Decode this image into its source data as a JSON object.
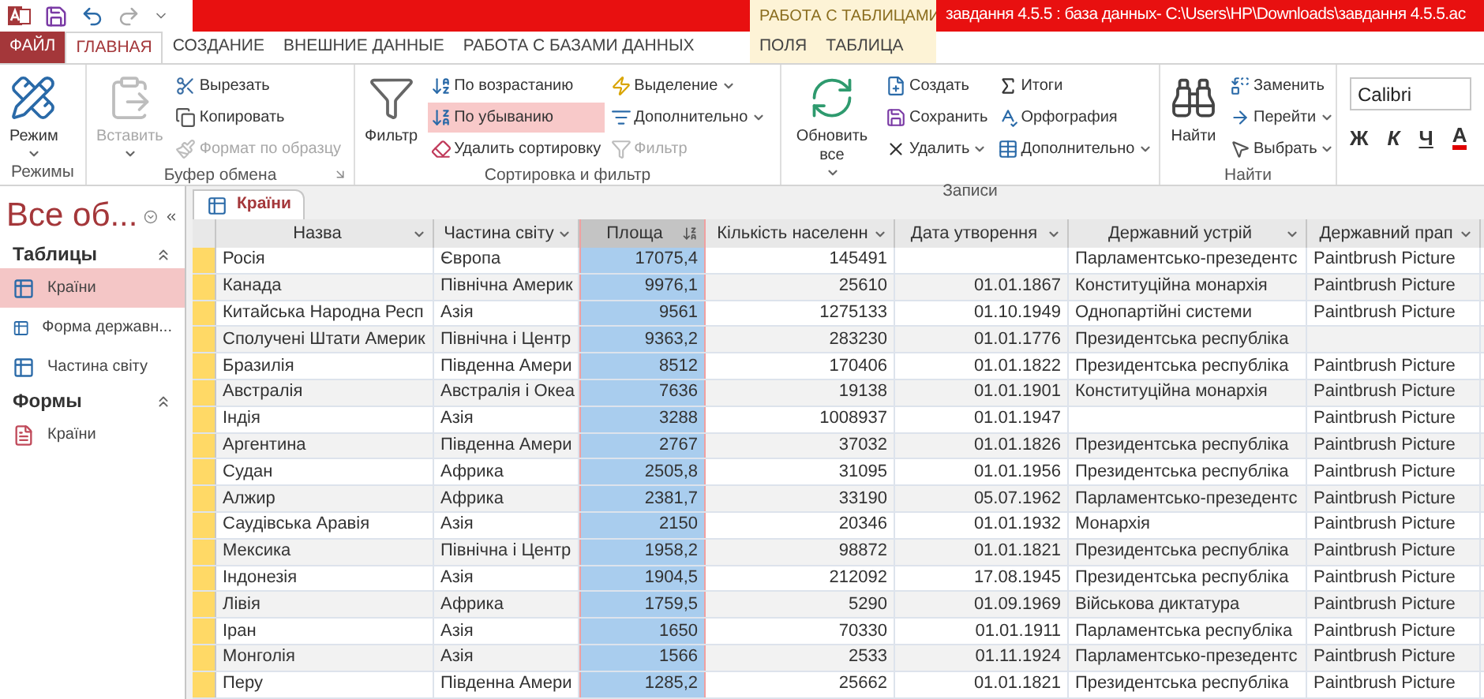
{
  "title": "завдання 4.5.5 : база данных- C:\\Users\\HP\\Downloads\\завдання 4.5.5.ac",
  "context_group": "РАБОТА С ТАБЛИЦАМИ",
  "tabs": [
    {
      "label": "ФАЙЛ",
      "kind": "file",
      "selected": false
    },
    {
      "label": "ГЛАВНАЯ",
      "kind": "main",
      "selected": true
    },
    {
      "label": "СОЗДАНИЕ",
      "kind": "main",
      "selected": false
    },
    {
      "label": "ВНЕШНИЕ ДАННЫЕ",
      "kind": "main",
      "selected": false
    },
    {
      "label": "РАБОТА С БАЗАМИ ДАННЫХ",
      "kind": "main",
      "selected": false
    },
    {
      "label": "ПОЛЯ",
      "kind": "context",
      "selected": false
    },
    {
      "label": "ТАБЛИЦА",
      "kind": "context",
      "selected": false
    }
  ],
  "ribbon": [
    {
      "label": "Режимы",
      "launcher": false,
      "columns": [
        [
          {
            "label": "Режим",
            "kind": "large",
            "dropdown": true,
            "disabled": false,
            "active": false
          }
        ]
      ]
    },
    {
      "label": "Буфер обмена",
      "launcher": true,
      "columns": [
        [
          {
            "label": "Вставить",
            "kind": "large",
            "dropdown": true,
            "disabled": true,
            "active": false
          }
        ],
        [
          {
            "label": "Вырезать",
            "kind": "small",
            "dropdown": false,
            "disabled": false,
            "active": false
          },
          {
            "label": "Копировать",
            "kind": "small",
            "dropdown": false,
            "disabled": false,
            "active": false
          },
          {
            "label": "Формат по образцу",
            "kind": "small",
            "dropdown": false,
            "disabled": true,
            "active": false
          }
        ]
      ]
    },
    {
      "label": "Сортировка и фильтр",
      "launcher": false,
      "columns": [
        [
          {
            "label": "Фильтр",
            "kind": "large",
            "dropdown": false,
            "disabled": false,
            "active": false
          }
        ],
        [
          {
            "label": "По возрастанию",
            "kind": "small",
            "dropdown": false,
            "disabled": false,
            "active": false
          },
          {
            "label": "По убыванию",
            "kind": "small",
            "dropdown": false,
            "disabled": false,
            "active": true
          },
          {
            "label": "Удалить сортировку",
            "kind": "small",
            "dropdown": false,
            "disabled": false,
            "active": false
          }
        ],
        [
          {
            "label": "Выделение",
            "kind": "small",
            "dropdown": true,
            "disabled": false,
            "active": false
          },
          {
            "label": "Дополнительно",
            "kind": "small",
            "dropdown": true,
            "disabled": false,
            "active": false
          },
          {
            "label": "Фильтр",
            "kind": "small",
            "dropdown": false,
            "disabled": true,
            "active": false
          }
        ]
      ]
    },
    {
      "label": "Записи",
      "launcher": false,
      "columns": [
        [
          {
            "label": "Обновить все",
            "kind": "large",
            "dropdown": true,
            "disabled": false,
            "active": false
          }
        ],
        [
          {
            "label": "Создать",
            "kind": "small",
            "dropdown": false,
            "disabled": false,
            "active": false
          },
          {
            "label": "Сохранить",
            "kind": "small",
            "dropdown": false,
            "disabled": false,
            "active": false
          },
          {
            "label": "Удалить",
            "kind": "small",
            "dropdown": true,
            "disabled": false,
            "active": false
          }
        ],
        [
          {
            "label": "Итоги",
            "kind": "small",
            "dropdown": false,
            "disabled": false,
            "active": false
          },
          {
            "label": "Орфография",
            "kind": "small",
            "dropdown": false,
            "disabled": false,
            "active": false
          },
          {
            "label": "Дополнительно",
            "kind": "small",
            "dropdown": true,
            "disabled": false,
            "active": false
          }
        ]
      ]
    },
    {
      "label": "Найти",
      "launcher": false,
      "columns": [
        [
          {
            "label": "Найти",
            "kind": "large",
            "dropdown": false,
            "disabled": false,
            "active": false
          }
        ],
        [
          {
            "label": "Заменить",
            "kind": "small",
            "dropdown": false,
            "disabled": false,
            "active": false
          },
          {
            "label": "Перейти",
            "kind": "small",
            "dropdown": true,
            "disabled": false,
            "active": false
          },
          {
            "label": "Выбрать",
            "kind": "small",
            "dropdown": true,
            "disabled": false,
            "active": false
          }
        ]
      ]
    }
  ],
  "font_group": {
    "font": "Calibri",
    "buttons": [
      {
        "label": "Ж",
        "kind": "bold"
      },
      {
        "label": "К",
        "kind": "italic"
      },
      {
        "label": "Ч",
        "kind": "underline"
      },
      {
        "label": "A",
        "kind": "color"
      }
    ]
  },
  "nav": {
    "title": "Все об...",
    "groups": [
      {
        "label": "Таблицы",
        "items": [
          {
            "label": "Країни",
            "kind": "table",
            "selected": true
          },
          {
            "label": "Форма державн...",
            "kind": "table",
            "selected": false
          },
          {
            "label": "Частина світу",
            "kind": "table",
            "selected": false
          }
        ]
      },
      {
        "label": "Формы",
        "items": [
          {
            "label": "Країни",
            "kind": "form",
            "selected": false
          }
        ]
      }
    ]
  },
  "document_tab": "Країни",
  "table": {
    "columns": [
      {
        "label": "Назва",
        "kind": "text",
        "selected": false,
        "sorted": false
      },
      {
        "label": "Частина світу",
        "kind": "text",
        "selected": false,
        "sorted": false
      },
      {
        "label": "Площа",
        "kind": "number",
        "selected": true,
        "sorted": true
      },
      {
        "label": "Кількість населенн",
        "kind": "number",
        "selected": false,
        "sorted": false
      },
      {
        "label": "Дата утворення",
        "kind": "number",
        "selected": false,
        "sorted": false
      },
      {
        "label": "Державний устрій",
        "kind": "text",
        "selected": false,
        "sorted": false
      },
      {
        "label": "Державний прап",
        "kind": "text",
        "selected": false,
        "sorted": false
      }
    ],
    "rows": [
      [
        "Росія",
        "Європа",
        "17075,4",
        "145491",
        null,
        "Парламентсько-презедентс",
        "Paintbrush Picture"
      ],
      [
        "Канада",
        "Північна Америк",
        "9976,1",
        "25610",
        "01.01.1867",
        "Конституційна монархія",
        "Paintbrush Picture"
      ],
      [
        "Китайська Народна Респ",
        "Азія",
        "9561",
        "1275133",
        "01.10.1949",
        "Однопартійні системи",
        "Paintbrush Picture"
      ],
      [
        "Сполучені Штати Америк",
        "Північна і Центр",
        "9363,2",
        "283230",
        "01.01.1776",
        "Президентська республіка",
        null
      ],
      [
        "Бразилія",
        "Південна Амери",
        "8512",
        "170406",
        "01.01.1822",
        "Президентська республіка",
        "Paintbrush Picture"
      ],
      [
        "Австралія",
        "Австралія і Океа",
        "7636",
        "19138",
        "01.01.1901",
        "Конституційна монархія",
        "Paintbrush Picture"
      ],
      [
        "Індія",
        "Азія",
        "3288",
        "1008937",
        "01.01.1947",
        null,
        "Paintbrush Picture"
      ],
      [
        "Аргентина",
        "Південна Амери",
        "2767",
        "37032",
        "01.01.1826",
        "Президентська республіка",
        "Paintbrush Picture"
      ],
      [
        "Судан",
        "Африка",
        "2505,8",
        "31095",
        "01.01.1956",
        "Президентська республіка",
        "Paintbrush Picture"
      ],
      [
        "Алжир",
        "Африка",
        "2381,7",
        "33190",
        "05.07.1962",
        "Парламентсько-презедентс",
        "Paintbrush Picture"
      ],
      [
        "Саудівська Аравія",
        "Азія",
        "2150",
        "20346",
        "01.01.1932",
        "Монархія",
        "Paintbrush Picture"
      ],
      [
        "Мексика",
        "Північна і Центр",
        "1958,2",
        "98872",
        "01.01.1821",
        "Президентська республіка",
        "Paintbrush Picture"
      ],
      [
        "Індонезія",
        "Азія",
        "1904,5",
        "212092",
        "17.08.1945",
        "Президентська республіка",
        "Paintbrush Picture"
      ],
      [
        "Лівія",
        "Африка",
        "1759,5",
        "5290",
        "01.09.1969",
        "Військова диктатура",
        "Paintbrush Picture"
      ],
      [
        "Іран",
        "Азія",
        "1650",
        "70330",
        "01.01.1911",
        "Парламентська республіка",
        "Paintbrush Picture"
      ],
      [
        "Монголія",
        "Азія",
        "1566",
        "2533",
        "01.11.1924",
        "Парламентсько-презедентс",
        "Paintbrush Picture"
      ],
      [
        "Перу",
        "Південна Амери",
        "1285,2",
        "25662",
        "01.01.1821",
        "Президентська республіка",
        "Paintbrush Picture"
      ]
    ]
  }
}
